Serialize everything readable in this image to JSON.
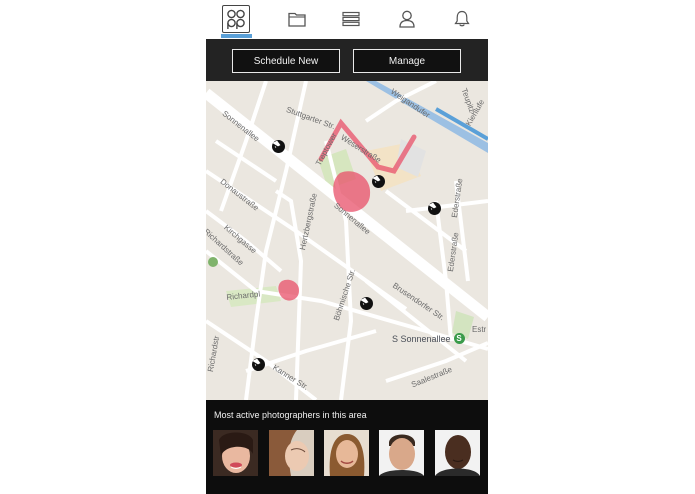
{
  "nav": {
    "logo_text": "oo\npp",
    "active_tab": "home",
    "icons": [
      "app-logo-icon",
      "folder-icon",
      "list-icon",
      "profile-icon",
      "notifications-bell-icon"
    ],
    "active_color": "#5aa0d8"
  },
  "actions": {
    "schedule_label": "Schedule New",
    "manage_label": "Manage"
  },
  "map": {
    "streets": {
      "sonnenallee_top": "Sonnenallee",
      "stuttgarter": "Stuttgarter Str.",
      "treptower": "Treptower",
      "weserstrasse": "Weserstraße",
      "weigandufer": "Weigandufer",
      "kiehlufer": "Kiehlufe",
      "donaustrasse": "Donaustraße",
      "kirchgasse": "Kirchgasse",
      "richardstrasse": "Richardstraße",
      "hertzbergstrasse": "Hertzbergstraße",
      "sonnenallee_mid": "Sonnenallee",
      "ederstrasse_1": "Ederstraße",
      "ederstrasse_2": "Ederstraße",
      "richardpl": "Richardpl",
      "boehmische": "Böhmische Str.",
      "brusendorfer": "Brusendorfer Str.",
      "estr": "Estr",
      "kanner": "Kanner Str.",
      "saalestrasse": "Saalestraße",
      "teupitzer": "Teupitz",
      "richardstr_2": "Richardstr"
    },
    "station_label": "S Sonnenallee",
    "station_badge": "S",
    "pin_count": 6,
    "hotspot_color": "#e8506a",
    "water_color": "#5aa0d8"
  },
  "panel": {
    "title": "Most active photographers in this area",
    "photographers": [
      "photographer-1",
      "photographer-2",
      "photographer-3",
      "photographer-4",
      "photographer-5"
    ]
  }
}
